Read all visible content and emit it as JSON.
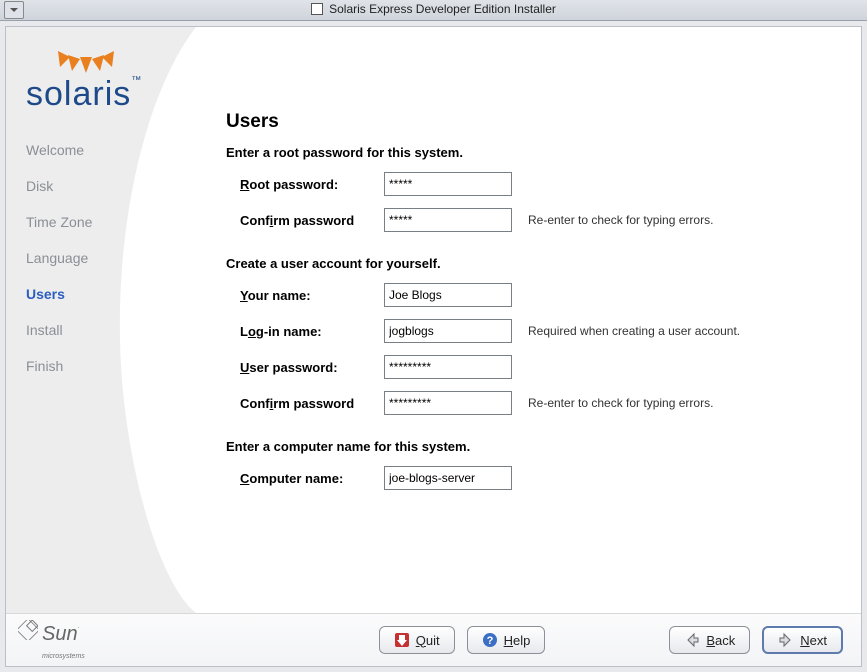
{
  "window": {
    "title": "Solaris Express Developer Edition Installer"
  },
  "brand": {
    "name": "solaris"
  },
  "sidebar": {
    "items": [
      {
        "label": "Welcome"
      },
      {
        "label": "Disk"
      },
      {
        "label": "Time Zone"
      },
      {
        "label": "Language"
      },
      {
        "label": "Users"
      },
      {
        "label": "Install"
      },
      {
        "label": "Finish"
      }
    ],
    "active_index": 4
  },
  "page": {
    "title": "Users",
    "section_root": "Enter a root password for this system.",
    "root_password_label_pre": "R",
    "root_password_label_post": "oot password:",
    "root_password_value": "*****",
    "confirm_root_label_pre": "Conf",
    "confirm_root_label_u": "i",
    "confirm_root_label_post": "rm password",
    "confirm_root_value": "*****",
    "confirm_root_hint": "Re-enter to check for typing errors.",
    "section_user": "Create a user account for yourself.",
    "your_name_label_pre": "Y",
    "your_name_label_post": "our name:",
    "your_name_value": "Joe Blogs",
    "login_label_pre": "L",
    "login_label_u": "o",
    "login_label_post": "g-in name:",
    "login_value": "jogblogs",
    "login_hint": "Required when creating a user account.",
    "user_pw_label_pre": "U",
    "user_pw_label_post": "ser password:",
    "user_pw_value": "*********",
    "confirm_user_label_pre": "Conf",
    "confirm_user_label_u": "i",
    "confirm_user_label_post": "rm password",
    "confirm_user_value": "*********",
    "confirm_user_hint": "Re-enter to check for typing errors.",
    "section_computer": "Enter a computer name for this system.",
    "computer_label_pre": "C",
    "computer_label_post": "omputer name:",
    "computer_value": "joe-blogs-server"
  },
  "footer": {
    "sun_text": "Sun",
    "sun_sub": "microsystems",
    "quit_pre": "Q",
    "quit_post": "uit",
    "help_pre": "H",
    "help_post": "elp",
    "back_pre": "B",
    "back_post": "ack",
    "next_pre": "N",
    "next_post": "ext"
  }
}
